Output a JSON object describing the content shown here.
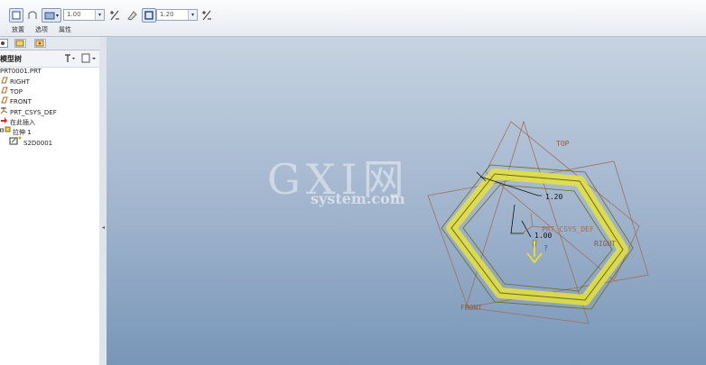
{
  "ribbon": {
    "value1": "1.00",
    "value2": "1.20",
    "tabs": [
      "放置",
      "选项",
      "属性"
    ]
  },
  "model_tree": {
    "title": "模型树",
    "items": [
      {
        "label": "PRT0001.PRT",
        "icon": "part-icon"
      },
      {
        "label": "RIGHT",
        "icon": "datum-plane-icon"
      },
      {
        "label": "TOP",
        "icon": "datum-plane-icon"
      },
      {
        "label": "FRONT",
        "icon": "datum-plane-icon"
      },
      {
        "label": "PRT_CSYS_DEF",
        "icon": "csys-icon"
      },
      {
        "label": "在此插入",
        "icon": "insert-here-icon"
      },
      {
        "label": "拉伸 1",
        "icon": "extrude-icon"
      },
      {
        "label": "S2D0001",
        "icon": "sketch-icon"
      }
    ]
  },
  "viewport": {
    "watermark_main": "GXI网",
    "watermark_sub": "system.com",
    "dim_thickness": "1.20",
    "dim_depth": "1.00",
    "label_top": "TOP",
    "label_front": "FRONT",
    "label_right": "RIGHT",
    "label_csys": "PRT_CSYS_DEF",
    "marker": "?"
  },
  "colors": {
    "feature_fill": "#e6e23c",
    "datum_plane": "#a0705a",
    "dimension": "#111111",
    "background_top": "#c6d3e2",
    "background_bottom": "#7896b8"
  }
}
